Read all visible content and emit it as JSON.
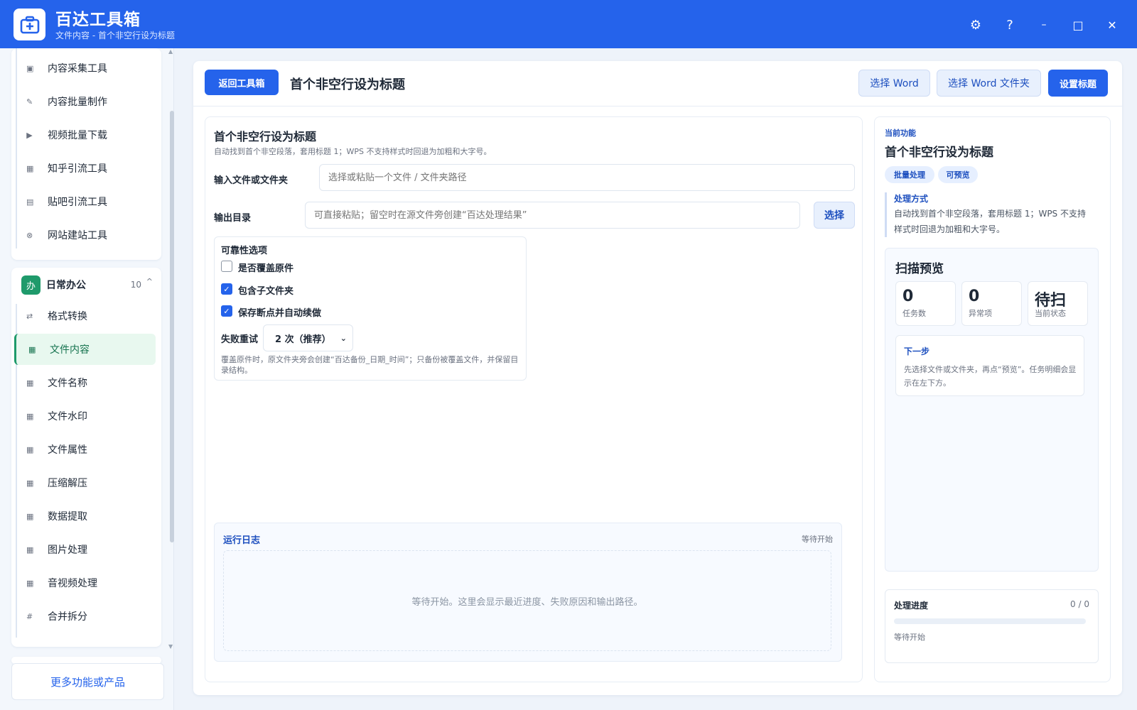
{
  "app": {
    "title": "百达工具箱",
    "subtitle": "文件内容 - 首个非空行设为标题",
    "controls": {
      "settings": "⚙",
      "help": "?",
      "minimize": "–",
      "maximize": "□",
      "close": "✕"
    }
  },
  "sidebar": {
    "top_items": [
      {
        "label": "内容采集工具",
        "icon": "▣"
      },
      {
        "label": "内容批量制作",
        "icon": "✎"
      },
      {
        "label": "视频批量下载",
        "icon": "▶"
      },
      {
        "label": "知乎引流工具",
        "icon": "▦"
      },
      {
        "label": "贴吧引流工具",
        "icon": "▤"
      },
      {
        "label": "网站建站工具",
        "icon": "⊗"
      }
    ],
    "group": {
      "badge": "办",
      "title": "日常办公",
      "count": "10",
      "caret": "^"
    },
    "group_items": [
      {
        "label": "格式转换",
        "icon": "⇄",
        "active": false
      },
      {
        "label": "文件内容",
        "icon": "▦",
        "active": true
      },
      {
        "label": "文件名称",
        "icon": "▦",
        "active": false
      },
      {
        "label": "文件水印",
        "icon": "▦",
        "active": false
      },
      {
        "label": "文件属性",
        "icon": "▦",
        "active": false
      },
      {
        "label": "压缩解压",
        "icon": "▦",
        "active": false
      },
      {
        "label": "数据提取",
        "icon": "▦",
        "active": false
      },
      {
        "label": "图片处理",
        "icon": "▦",
        "active": false
      },
      {
        "label": "音视频处理",
        "icon": "▦",
        "active": false
      },
      {
        "label": "合并拆分",
        "icon": "#",
        "active": false
      }
    ],
    "more_label": "更多功能或产品"
  },
  "toolbar": {
    "back_label": "返回工具箱",
    "title": "首个非空行设为标题",
    "select_word": "选择 Word",
    "select_word_folder": "选择 Word 文件夹",
    "set_title": "设置标题"
  },
  "form": {
    "heading": "首个非空行设为标题",
    "description": "自动找到首个非空段落，套用标题 1；WPS 不支持样式时回退为加粗和大字号。",
    "input_label": "输入文件或文件夹",
    "input_placeholder": "选择或粘贴一个文件 / 文件夹路径",
    "output_label": "输出目录",
    "output_placeholder": "可直接粘贴；留空时在源文件旁创建“百达处理结果”",
    "output_button": "选择",
    "options": {
      "title": "可靠性选项",
      "overwrite": {
        "label": "是否覆盖原件",
        "checked": false
      },
      "subfolders": {
        "label": "包含子文件夹",
        "checked": true
      },
      "resume": {
        "label": "保存断点并自动续做",
        "checked": true
      },
      "retry_label": "失败重试",
      "retry_value": "2 次（推荐）",
      "note": "覆盖原件时，原文件夹旁会创建“百达备份_日期_时间”；只备份被覆盖文件，并保留目录结构。"
    }
  },
  "log": {
    "title": "运行日志",
    "status": "等待开始",
    "placeholder": "等待开始。这里会显示最近进度、失败原因和输出路径。"
  },
  "info": {
    "eyebrow": "当前功能",
    "title": "首个非空行设为标题",
    "tags": [
      "批量处理",
      "可预览"
    ],
    "method_title": "处理方式",
    "method_text": "自动找到首个非空段落，套用标题 1；WPS 不支持样式时回退为加粗和大字号。",
    "scan": {
      "title": "扫描预览",
      "stats": [
        {
          "value": "0",
          "label": "任务数"
        },
        {
          "value": "0",
          "label": "异常项"
        },
        {
          "value": "待扫",
          "label": "当前状态"
        }
      ],
      "next_title": "下一步",
      "next_text": "先选择文件或文件夹，再点“预览”。任务明细会显示在左下方。"
    },
    "progress": {
      "title": "处理进度",
      "count": "0 / 0",
      "fraction": 0,
      "status": "等待开始"
    }
  },
  "colors": {
    "primary": "#2563eb",
    "active_green": "#1f9a6b"
  }
}
